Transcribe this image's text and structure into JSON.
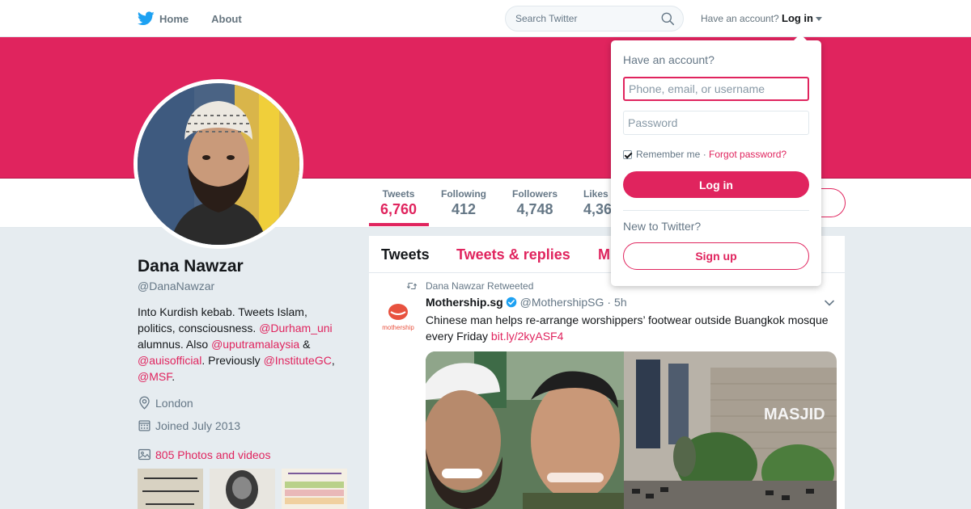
{
  "nav": {
    "home_label": "Home",
    "about_label": "About",
    "search_placeholder": "Search Twitter",
    "account_question": "Have an account?",
    "login_label": "Log in"
  },
  "colors": {
    "accent": "#e0245e",
    "twitter_blue": "#1da1f2",
    "background": "#e6ecf0"
  },
  "profile": {
    "name": "Dana Nawzar",
    "handle": "@DanaNawzar",
    "bio_text_1": "Into Kurdish kebab. Tweets Islam, politics, consciousness.",
    "bio_mention_1": "@Durham_uni",
    "bio_text_2": " alumnus. Also ",
    "bio_mention_2": "@uputramalaysia",
    "bio_text_3": " & ",
    "bio_mention_3": "@auisofficial",
    "bio_text_4": ". Previously ",
    "bio_mention_4": "@InstituteGC",
    "bio_text_5": ", ",
    "bio_mention_5": "@MSF",
    "bio_text_6": ".",
    "location": "London",
    "joined": "Joined July 2013",
    "photos_label": "805 Photos and videos"
  },
  "stats": [
    {
      "label": "Tweets",
      "value": "6,760"
    },
    {
      "label": "Following",
      "value": "412"
    },
    {
      "label": "Followers",
      "value": "4,748"
    },
    {
      "label": "Likes",
      "value": "4,36"
    }
  ],
  "timeline": {
    "tabs": [
      "Tweets",
      "Tweets & replies",
      "M"
    ],
    "tweet": {
      "retweet_note": "Dana Nawzar Retweeted",
      "user_name": "Mothership.sg",
      "user_handle": "@MothershipSG",
      "separator": "·",
      "time": "5h",
      "text": "Chinese man helps re-arrange worshippers’ footwear outside Buangkok mosque every Friday ",
      "link": "bit.ly/2kyASF4",
      "avatar_text": "mothership",
      "media_sign": "MASJID"
    }
  },
  "login_dropdown": {
    "title": "Have an account?",
    "username_placeholder": "Phone, email, or username",
    "password_placeholder": "Password",
    "remember_label": "Remember me",
    "separator": " · ",
    "forgot_label": "Forgot password?",
    "login_button": "Log in",
    "new_prompt": "New to Twitter?",
    "signup_button": "Sign up"
  }
}
